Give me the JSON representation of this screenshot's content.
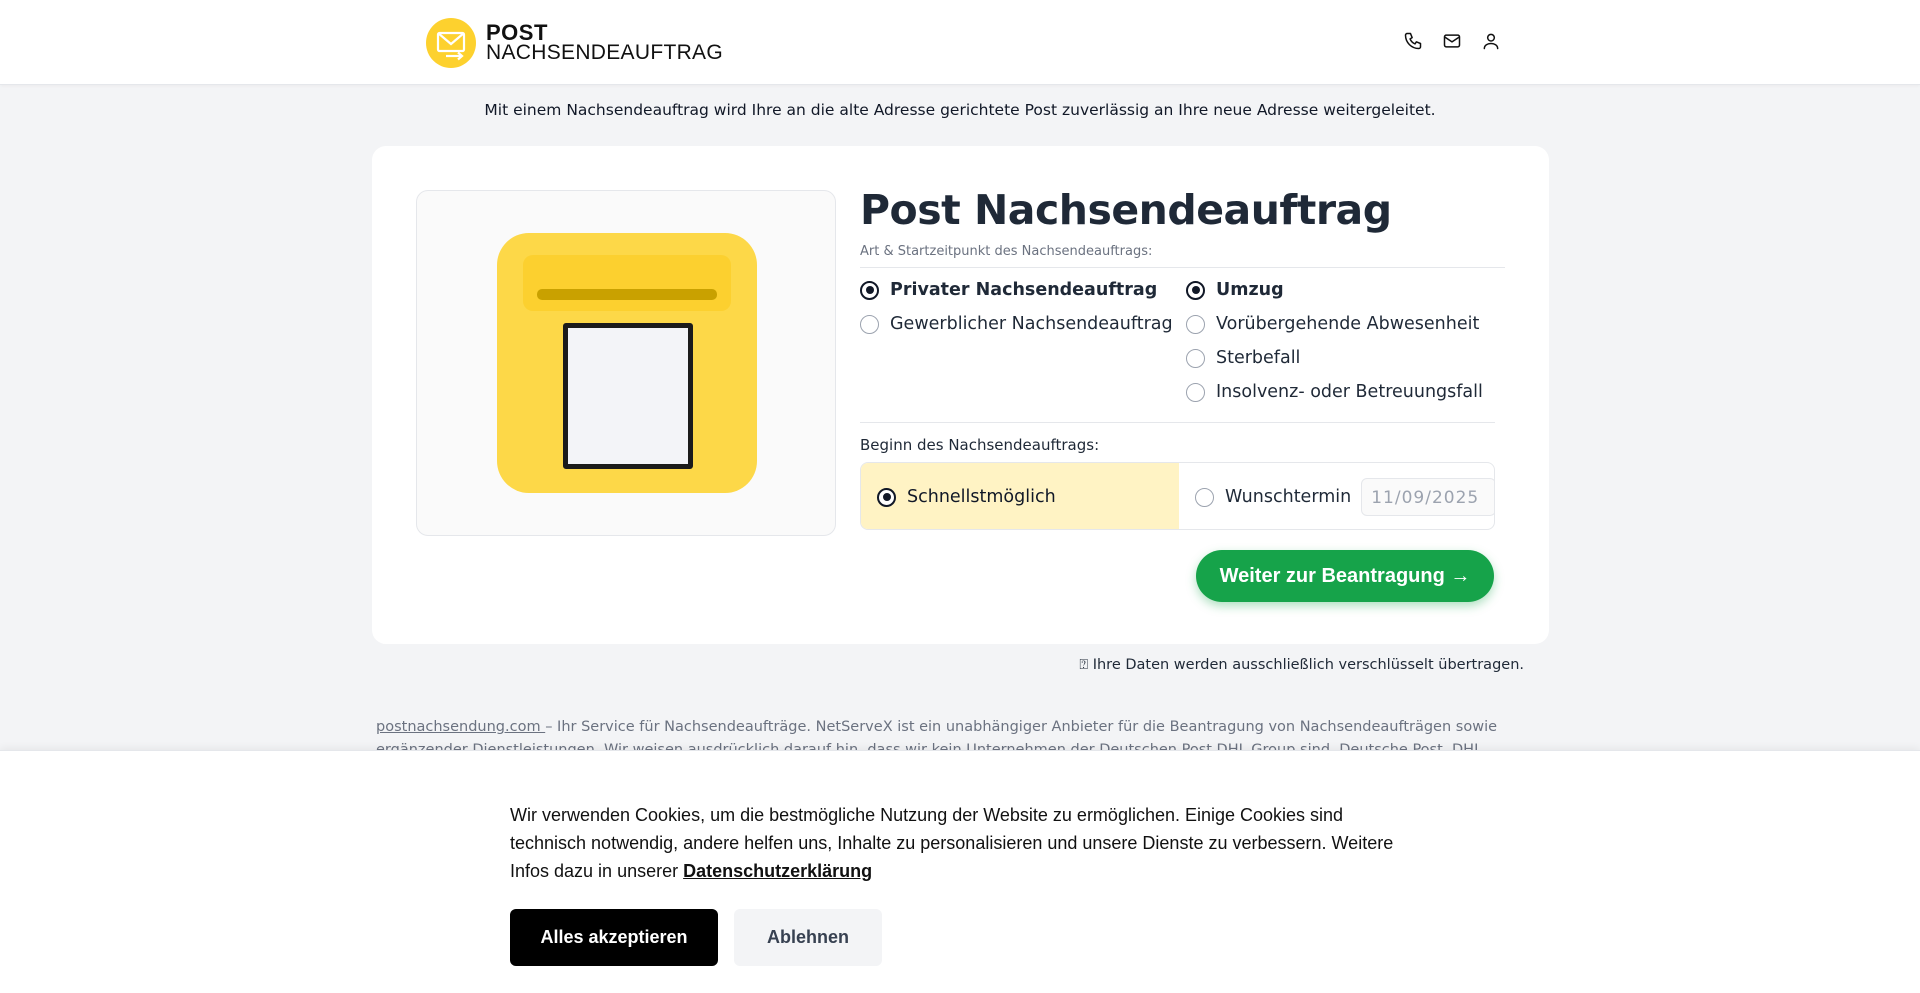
{
  "header": {
    "logo_line1": "POST",
    "logo_line2": "NACHSENDEAUFTRAG",
    "icons": [
      "phone-icon",
      "mail-icon",
      "user-icon"
    ]
  },
  "intro": "Mit einem Nachsendeauftrag wird Ihre an die alte Adresse gerichtete Post zuverlässig an Ihre neue Adresse weitergeleitet.",
  "form": {
    "title": "Post Nachsendeauftrag",
    "subtitle": "Art & Startzeitpunkt des Nachsendeauftrags:",
    "type_options": [
      {
        "label": "Privater Nachsendeauftrag",
        "selected": true
      },
      {
        "label": "Gewerblicher Nachsendeauftrag",
        "selected": false
      }
    ],
    "reason_options": [
      {
        "label": "Umzug",
        "selected": true
      },
      {
        "label": "Vorübergehende Abwesenheit",
        "selected": false
      },
      {
        "label": "Sterbefall",
        "selected": false
      },
      {
        "label": "Insolvenz- oder Betreuungsfall",
        "selected": false
      }
    ],
    "start_label": "Beginn des Nachsendeauftrags:",
    "start_asap": "Schnellstmöglich",
    "start_custom": "Wunschtermin",
    "date_placeholder": "11/09/2025",
    "submit_label": "Weiter zur Beantragung →"
  },
  "secure_note": "⍰ Ihre Daten werden ausschließlich verschlüsselt übertragen.",
  "footer": {
    "link_text": "postnachsendung.com ",
    "text": " – Ihr Service für Nachsendeaufträge. NetServeX ist ein unabhängiger Anbieter für die Beantragung von Nachsendeaufträgen sowie ergänzender Dienstleistungen. Wir weisen ausdrücklich darauf hin, dass wir kein Unternehmen der Deutschen Post DHL Group sind. Deutsche Post, DHL, DHL Paket und Dialogpost sind"
  },
  "cookie": {
    "text": "Wir verwenden Cookies, um die bestmögliche Nutzung der Website zu ermöglichen. Einige Cookies sind technisch notwendig, andere helfen uns, Inhalte zu personalisieren und unsere Dienste zu verbessern. Weitere Infos dazu in unserer ",
    "link": "Datenschutzerklärung",
    "accept": "Alles akzeptieren",
    "decline": "Ablehnen"
  },
  "colors": {
    "brand_yellow": "#fdd848",
    "cta_green": "#16a34a",
    "asap_highlight": "#fff3c4"
  }
}
